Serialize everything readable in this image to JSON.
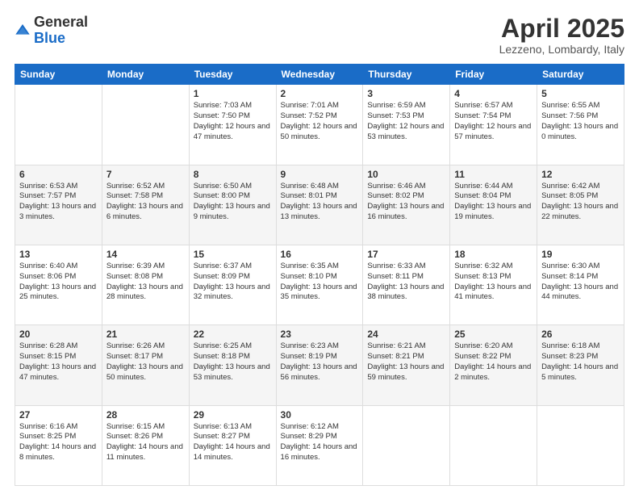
{
  "header": {
    "logo_general": "General",
    "logo_blue": "Blue",
    "month_title": "April 2025",
    "location": "Lezzeno, Lombardy, Italy"
  },
  "days_of_week": [
    "Sunday",
    "Monday",
    "Tuesday",
    "Wednesday",
    "Thursday",
    "Friday",
    "Saturday"
  ],
  "weeks": [
    [
      {
        "day": "",
        "info": ""
      },
      {
        "day": "",
        "info": ""
      },
      {
        "day": "1",
        "info": "Sunrise: 7:03 AM\nSunset: 7:50 PM\nDaylight: 12 hours and 47 minutes."
      },
      {
        "day": "2",
        "info": "Sunrise: 7:01 AM\nSunset: 7:52 PM\nDaylight: 12 hours and 50 minutes."
      },
      {
        "day": "3",
        "info": "Sunrise: 6:59 AM\nSunset: 7:53 PM\nDaylight: 12 hours and 53 minutes."
      },
      {
        "day": "4",
        "info": "Sunrise: 6:57 AM\nSunset: 7:54 PM\nDaylight: 12 hours and 57 minutes."
      },
      {
        "day": "5",
        "info": "Sunrise: 6:55 AM\nSunset: 7:56 PM\nDaylight: 13 hours and 0 minutes."
      }
    ],
    [
      {
        "day": "6",
        "info": "Sunrise: 6:53 AM\nSunset: 7:57 PM\nDaylight: 13 hours and 3 minutes."
      },
      {
        "day": "7",
        "info": "Sunrise: 6:52 AM\nSunset: 7:58 PM\nDaylight: 13 hours and 6 minutes."
      },
      {
        "day": "8",
        "info": "Sunrise: 6:50 AM\nSunset: 8:00 PM\nDaylight: 13 hours and 9 minutes."
      },
      {
        "day": "9",
        "info": "Sunrise: 6:48 AM\nSunset: 8:01 PM\nDaylight: 13 hours and 13 minutes."
      },
      {
        "day": "10",
        "info": "Sunrise: 6:46 AM\nSunset: 8:02 PM\nDaylight: 13 hours and 16 minutes."
      },
      {
        "day": "11",
        "info": "Sunrise: 6:44 AM\nSunset: 8:04 PM\nDaylight: 13 hours and 19 minutes."
      },
      {
        "day": "12",
        "info": "Sunrise: 6:42 AM\nSunset: 8:05 PM\nDaylight: 13 hours and 22 minutes."
      }
    ],
    [
      {
        "day": "13",
        "info": "Sunrise: 6:40 AM\nSunset: 8:06 PM\nDaylight: 13 hours and 25 minutes."
      },
      {
        "day": "14",
        "info": "Sunrise: 6:39 AM\nSunset: 8:08 PM\nDaylight: 13 hours and 28 minutes."
      },
      {
        "day": "15",
        "info": "Sunrise: 6:37 AM\nSunset: 8:09 PM\nDaylight: 13 hours and 32 minutes."
      },
      {
        "day": "16",
        "info": "Sunrise: 6:35 AM\nSunset: 8:10 PM\nDaylight: 13 hours and 35 minutes."
      },
      {
        "day": "17",
        "info": "Sunrise: 6:33 AM\nSunset: 8:11 PM\nDaylight: 13 hours and 38 minutes."
      },
      {
        "day": "18",
        "info": "Sunrise: 6:32 AM\nSunset: 8:13 PM\nDaylight: 13 hours and 41 minutes."
      },
      {
        "day": "19",
        "info": "Sunrise: 6:30 AM\nSunset: 8:14 PM\nDaylight: 13 hours and 44 minutes."
      }
    ],
    [
      {
        "day": "20",
        "info": "Sunrise: 6:28 AM\nSunset: 8:15 PM\nDaylight: 13 hours and 47 minutes."
      },
      {
        "day": "21",
        "info": "Sunrise: 6:26 AM\nSunset: 8:17 PM\nDaylight: 13 hours and 50 minutes."
      },
      {
        "day": "22",
        "info": "Sunrise: 6:25 AM\nSunset: 8:18 PM\nDaylight: 13 hours and 53 minutes."
      },
      {
        "day": "23",
        "info": "Sunrise: 6:23 AM\nSunset: 8:19 PM\nDaylight: 13 hours and 56 minutes."
      },
      {
        "day": "24",
        "info": "Sunrise: 6:21 AM\nSunset: 8:21 PM\nDaylight: 13 hours and 59 minutes."
      },
      {
        "day": "25",
        "info": "Sunrise: 6:20 AM\nSunset: 8:22 PM\nDaylight: 14 hours and 2 minutes."
      },
      {
        "day": "26",
        "info": "Sunrise: 6:18 AM\nSunset: 8:23 PM\nDaylight: 14 hours and 5 minutes."
      }
    ],
    [
      {
        "day": "27",
        "info": "Sunrise: 6:16 AM\nSunset: 8:25 PM\nDaylight: 14 hours and 8 minutes."
      },
      {
        "day": "28",
        "info": "Sunrise: 6:15 AM\nSunset: 8:26 PM\nDaylight: 14 hours and 11 minutes."
      },
      {
        "day": "29",
        "info": "Sunrise: 6:13 AM\nSunset: 8:27 PM\nDaylight: 14 hours and 14 minutes."
      },
      {
        "day": "30",
        "info": "Sunrise: 6:12 AM\nSunset: 8:29 PM\nDaylight: 14 hours and 16 minutes."
      },
      {
        "day": "",
        "info": ""
      },
      {
        "day": "",
        "info": ""
      },
      {
        "day": "",
        "info": ""
      }
    ]
  ]
}
